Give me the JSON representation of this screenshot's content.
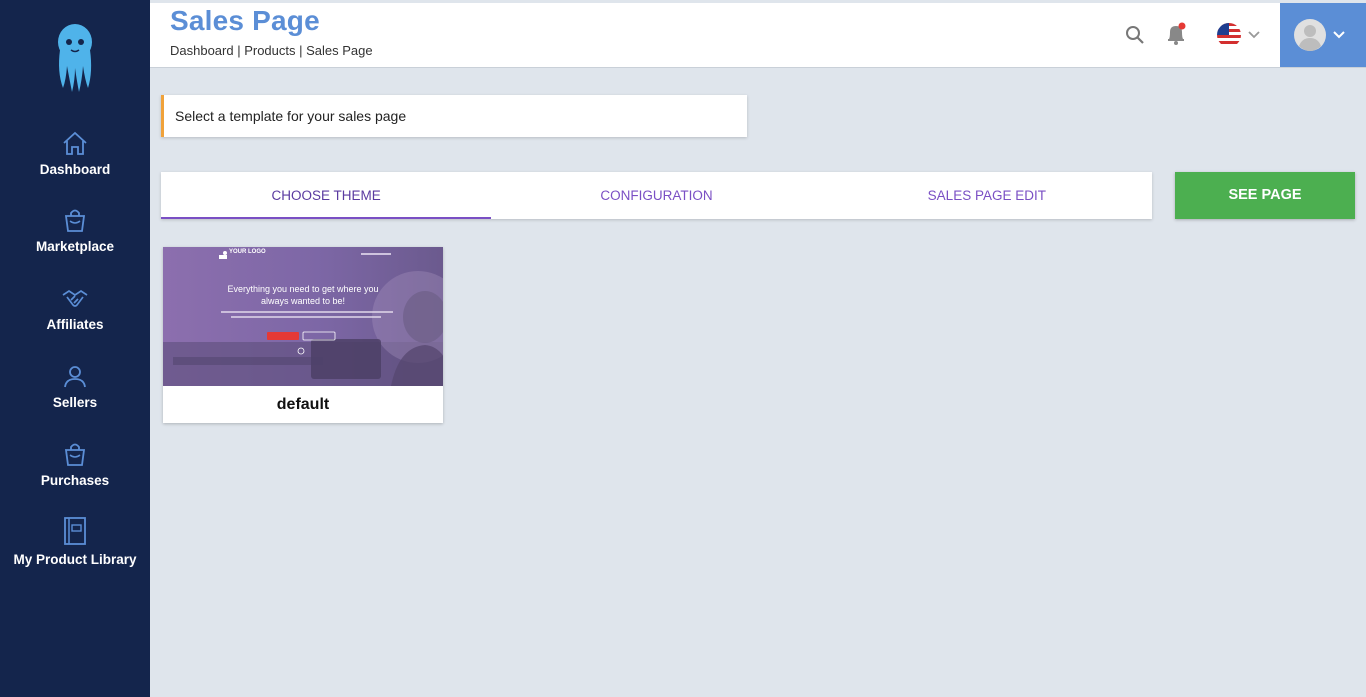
{
  "sidebar": {
    "items": [
      {
        "label": "Dashboard",
        "icon": "home-icon"
      },
      {
        "label": "Marketplace",
        "icon": "shopping-bag-icon"
      },
      {
        "label": "Affiliates",
        "icon": "handshake-icon"
      },
      {
        "label": "Sellers",
        "icon": "users-icon"
      },
      {
        "label": "Purchases",
        "icon": "shopping-bag-icon"
      },
      {
        "label": "My Product Library",
        "icon": "book-icon"
      }
    ]
  },
  "header": {
    "title": "Sales Page",
    "breadcrumb": "Dashboard | Products | Sales Page"
  },
  "info": {
    "message": "Select a template for your sales page"
  },
  "tabs": [
    {
      "label": "CHOOSE THEME",
      "active": true
    },
    {
      "label": "CONFIGURATION",
      "active": false
    },
    {
      "label": "SALES PAGE EDIT",
      "active": false
    }
  ],
  "see_page_label": "SEE PAGE",
  "themes": [
    {
      "name": "default",
      "preview": {
        "logo_text": "YOUR LOGO",
        "headline_line1": "Everything you need to get where you",
        "headline_line2": "always wanted to be!"
      }
    }
  ],
  "colors": {
    "sidebar": "#14254c",
    "accent": "#5b8ed6",
    "tab_text": "#7a4fc4",
    "see_page": "#4caf50",
    "info_border": "#f0a23a"
  }
}
